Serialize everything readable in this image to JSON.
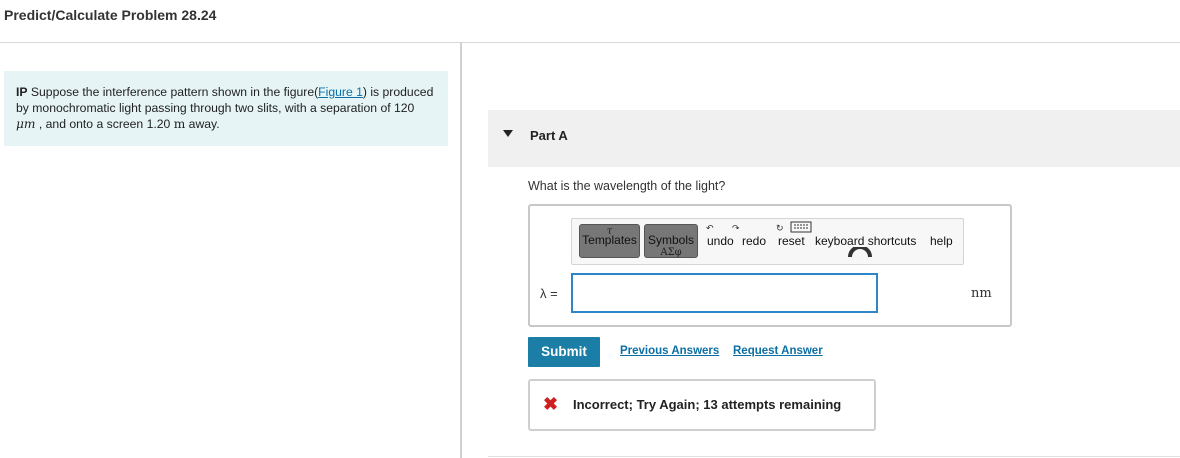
{
  "header": {
    "title": "Predict/Calculate Problem 28.24"
  },
  "problem": {
    "prefix": "IP",
    "text1": " Suppose the interference pattern shown in the figure(",
    "figure_link": "Figure 1",
    "text2": ") is produced by monochromatic light passing through two slits, with a separation of 120 ",
    "unit_um": "μm",
    "text3": " , and onto a screen 1.20 ",
    "unit_m": "m",
    "text4": " away."
  },
  "part": {
    "title": "Part A",
    "question": "What is the wavelength of the light?"
  },
  "toolbar": {
    "templates_label": "Templates",
    "symbols_label": "Symbols",
    "undo_label": "undo",
    "redo_label": "redo",
    "reset_label": "reset",
    "shortcuts_label": "keyboard shortcuts",
    "help_label": "help",
    "symbols_glyph": "ΑΣφ"
  },
  "answer": {
    "variable": "λ =",
    "value": "",
    "unit": "nm"
  },
  "actions": {
    "submit_label": "Submit",
    "previous_answers_label": "Previous Answers",
    "request_answer_label": "Request Answer"
  },
  "feedback": {
    "text": "Incorrect; Try Again; 13 attempts remaining"
  },
  "colors": {
    "accent": "#1b7ea6",
    "error": "#d01f1f",
    "problem_bg": "#e6f4f6"
  }
}
